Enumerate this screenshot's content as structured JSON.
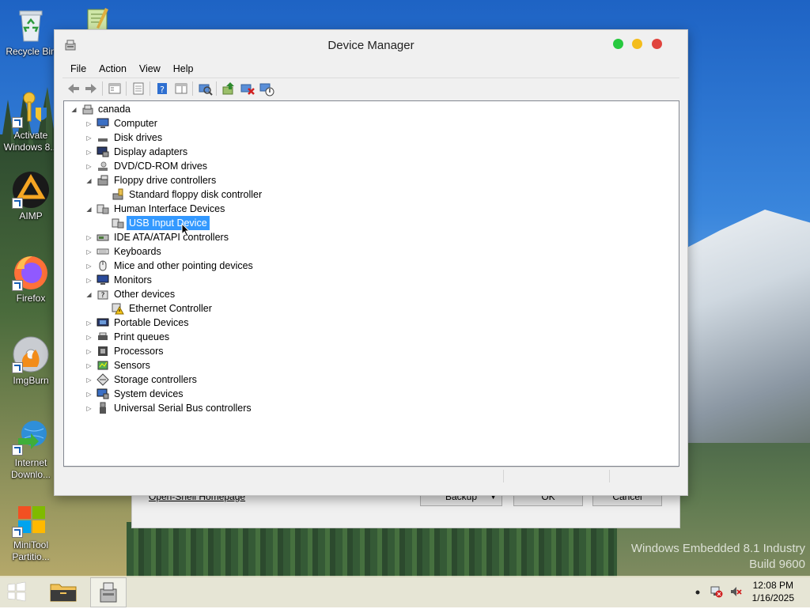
{
  "desktop": {
    "icons": [
      {
        "label": "Recycle Bin"
      },
      {
        "label": ""
      },
      {
        "label": "Activate Windows 8..."
      },
      {
        "label": "AIMP"
      },
      {
        "label": "Firefox"
      },
      {
        "label": "ImgBurn"
      },
      {
        "label": "Internet Downlo..."
      },
      {
        "label": "MiniTool Partitio..."
      }
    ],
    "watermark_line1": "Windows Embedded 8.1 Industry",
    "watermark_line2": "Build 9600"
  },
  "background_dialog": {
    "link": "Open-Shell Homepage",
    "backup_label": "Backup",
    "ok_label": "OK",
    "cancel_label": "Cancel"
  },
  "window": {
    "title": "Device Manager",
    "menu": [
      "File",
      "Action",
      "View",
      "Help"
    ],
    "toolbar_icons": [
      "back-icon",
      "forward-icon",
      "show-hide-console-tree-icon",
      "properties-icon",
      "help-icon",
      "show-hide-action-pane-icon",
      "scan-hardware-icon",
      "update-driver-icon",
      "uninstall-device-icon",
      "disable-device-icon"
    ],
    "tree": {
      "root": "canada",
      "items": [
        {
          "label": "Computer",
          "expanded": false,
          "children": []
        },
        {
          "label": "Disk drives",
          "expanded": false,
          "children": []
        },
        {
          "label": "Display adapters",
          "expanded": false,
          "children": []
        },
        {
          "label": "DVD/CD-ROM drives",
          "expanded": false,
          "children": []
        },
        {
          "label": "Floppy drive controllers",
          "expanded": true,
          "children": [
            "Standard floppy disk controller"
          ]
        },
        {
          "label": "Human Interface Devices",
          "expanded": true,
          "children": [
            "USB Input Device"
          ]
        },
        {
          "label": "IDE ATA/ATAPI controllers",
          "expanded": false,
          "children": []
        },
        {
          "label": "Keyboards",
          "expanded": false,
          "children": []
        },
        {
          "label": "Mice and other pointing devices",
          "expanded": false,
          "children": []
        },
        {
          "label": "Monitors",
          "expanded": false,
          "children": []
        },
        {
          "label": "Other devices",
          "expanded": true,
          "children": [
            "Ethernet Controller"
          ]
        },
        {
          "label": "Portable Devices",
          "expanded": false,
          "children": []
        },
        {
          "label": "Print queues",
          "expanded": false,
          "children": []
        },
        {
          "label": "Processors",
          "expanded": false,
          "children": []
        },
        {
          "label": "Sensors",
          "expanded": false,
          "children": []
        },
        {
          "label": "Storage controllers",
          "expanded": false,
          "children": []
        },
        {
          "label": "System devices",
          "expanded": false,
          "children": []
        },
        {
          "label": "Universal Serial Bus controllers",
          "expanded": false,
          "children": []
        }
      ],
      "selected": "USB Input Device"
    }
  },
  "taskbar": {
    "time": "12:08 PM",
    "date": "1/16/2025"
  },
  "colors": {
    "selection": "#3399ff",
    "close_dot": "#e0443e",
    "minimize_dot": "#f4bd1c",
    "maximize_dot": "#27c93f"
  }
}
